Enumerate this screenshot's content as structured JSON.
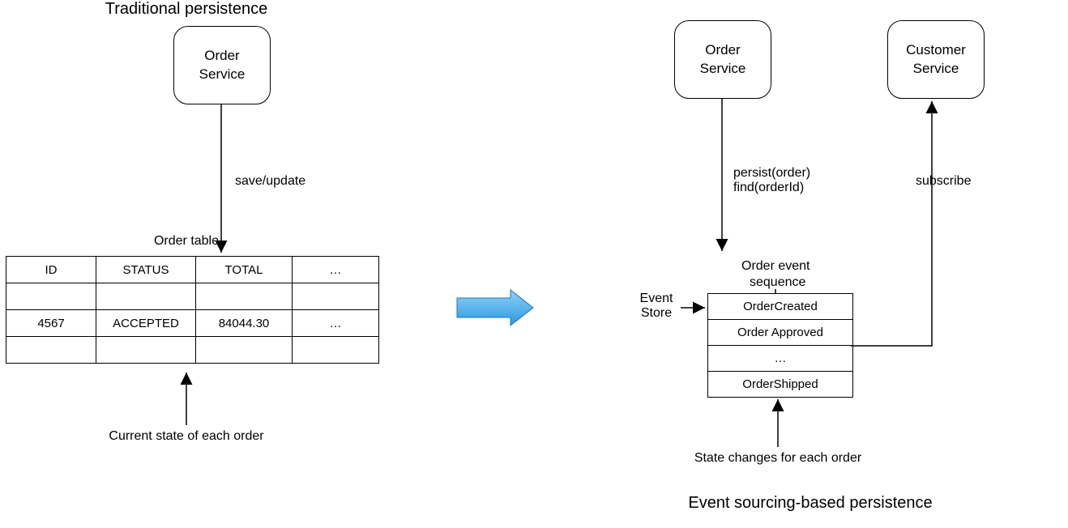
{
  "leftPanel": {
    "title": "Traditional persistence",
    "service": "Order\nService",
    "tableCaption": "Order table",
    "headers": [
      "ID",
      "STATUS",
      "TOTAL",
      "…"
    ],
    "row": [
      "4567",
      "ACCEPTED",
      "84044.30",
      "…"
    ],
    "footnote": "Current state of each order"
  },
  "rightPanel": {
    "title": "Event sourcing-based persistence",
    "services": [
      "Order\nService",
      "Customer\nService"
    ],
    "seqLabelTop": "Order event",
    "seqLabelBottom": "sequence",
    "seq": [
      "OrderCreated",
      "Order Approved",
      "…",
      "OrderShipped"
    ],
    "footnote": "State changes for each order"
  },
  "arrows": {
    "saveUpdate": "save/update",
    "persistFind": "persist(order)\nfind(orderId)",
    "eventStore": "Event\nStore",
    "subscribe": "subscribe"
  }
}
